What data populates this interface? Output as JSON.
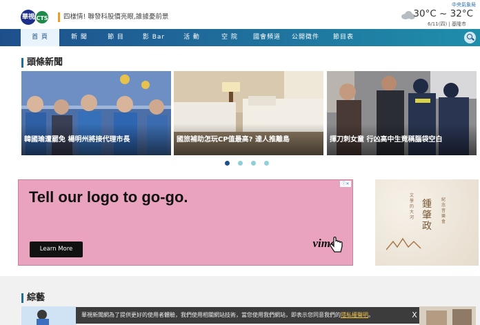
{
  "header": {
    "logo_text_a": "華視",
    "logo_text_b": "CTS",
    "ticker": "四樣情! 聯發科股價亮眼,誰據憂前景",
    "weather": {
      "station": "中央氣象局",
      "temp_range": "30°C ~ 32°C",
      "date_city": "6/11(四) | 基隆市"
    }
  },
  "nav": {
    "items": [
      "首 頁",
      "新 聞",
      "節 目",
      "影 Bar",
      "活 動",
      "空 院",
      "國會頻道",
      "公開徵件",
      "節目表"
    ],
    "active_index": 0
  },
  "headlines": {
    "title": "頭條新聞",
    "cards": [
      {
        "caption": "韓國瑜遭罷免 楊明州將接代理市長"
      },
      {
        "caption": "國旅補助怎玩CP值最高? 達人推離島"
      },
      {
        "caption": "揮刀刺女童 行凶高中生竟稱腦袋空白"
      }
    ],
    "dots": 4,
    "active_dot": 0
  },
  "ad": {
    "headline": "Tell our logo to go-go.",
    "cta_label": "Learn More",
    "brand": "vimeo",
    "badge": "ⓘ✕"
  },
  "promo": {
    "title": "鍾肇政",
    "sub_left": "文學的大河",
    "sub_right": "紀念音樂會"
  },
  "variety": {
    "title": "綜藝"
  },
  "cookie": {
    "text": "華視新聞網為了提供更好的使用者體驗，我們使用相關網站技術，當您使用我們網站，即表示您同意我們的",
    "link": "隱私權聲明",
    "tail": "。",
    "close": "X"
  },
  "colors": {
    "nav_start": "#1e4f8c",
    "nav_end": "#1f8eab",
    "accent_dot": "#1f4f8c",
    "ad_bg": "#e9a3be"
  }
}
